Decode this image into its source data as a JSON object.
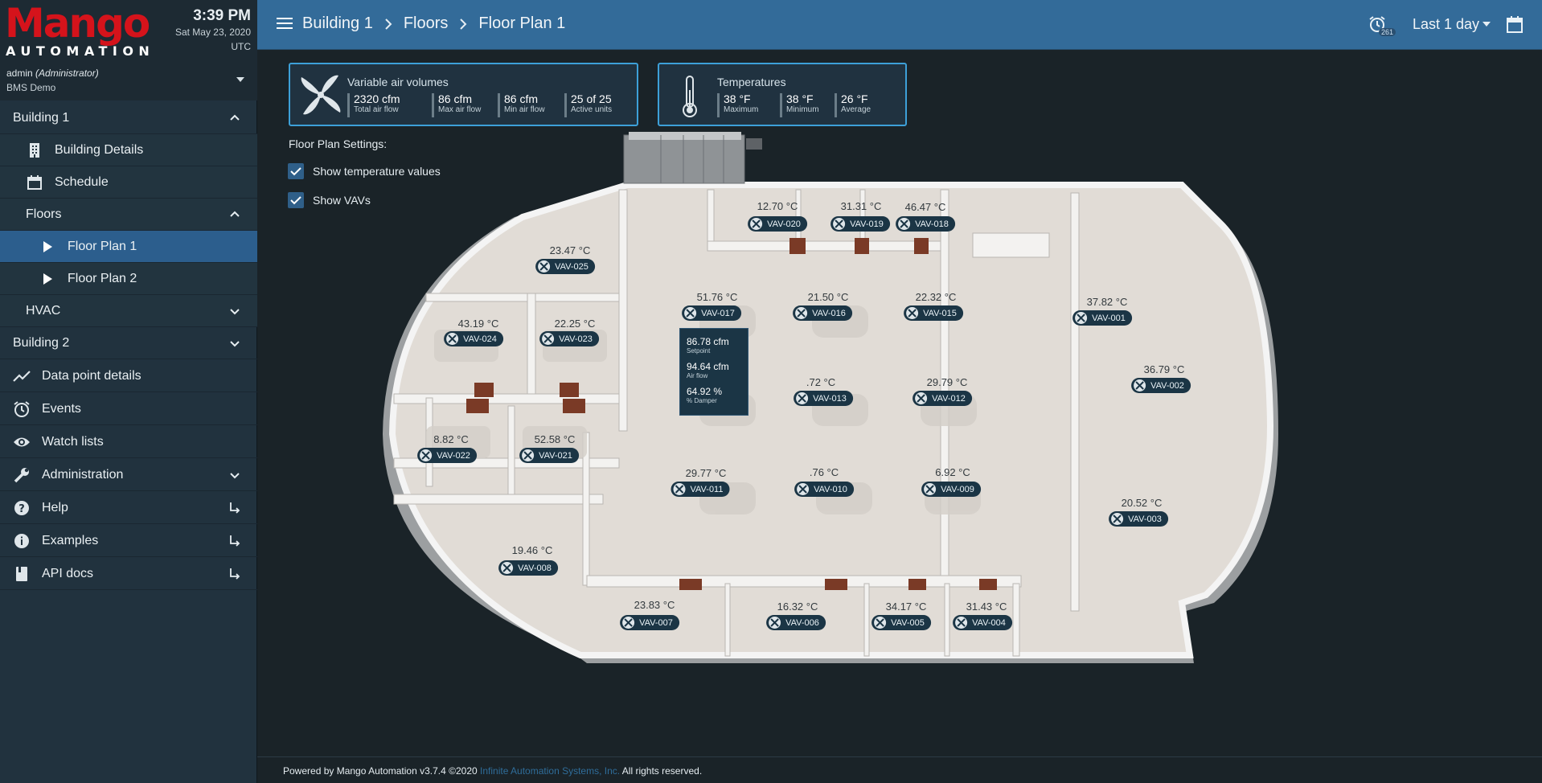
{
  "brand": {
    "logo_word": "Mango",
    "logo_sub": "AUTOMATION"
  },
  "clock": {
    "time": "3:39 PM",
    "date": "Sat May 23, 2020",
    "tz": "UTC"
  },
  "user": {
    "name": "admin",
    "role": "(Administrator)",
    "org": "BMS Demo"
  },
  "sidebar": {
    "items": [
      {
        "label": "Building 1",
        "icon": "chevron-up-icon"
      },
      {
        "label": "Building Details",
        "icon": "building-icon"
      },
      {
        "label": "Schedule",
        "icon": "calendar-icon"
      },
      {
        "label": "Floors",
        "icon": "chevron-up-icon"
      },
      {
        "label": "Floor Plan 1",
        "icon": "play-icon"
      },
      {
        "label": "Floor Plan 2",
        "icon": "play-icon"
      },
      {
        "label": "HVAC",
        "icon": "chevron-down-icon"
      },
      {
        "label": "Building 2",
        "icon": "chevron-down-icon"
      },
      {
        "label": "Data point details",
        "icon": "trending-icon"
      },
      {
        "label": "Events",
        "icon": "alarm-icon"
      },
      {
        "label": "Watch lists",
        "icon": "eye-icon"
      },
      {
        "label": "Administration",
        "icon": "wrench-icon"
      },
      {
        "label": "Help",
        "icon": "help-icon"
      },
      {
        "label": "Examples",
        "icon": "info-icon"
      },
      {
        "label": "API docs",
        "icon": "book-icon"
      }
    ]
  },
  "topbar": {
    "breadcrumbs": [
      "Building 1",
      "Floors",
      "Floor Plan 1"
    ],
    "history_badge": "261",
    "range_label": "Last 1 day"
  },
  "cards": {
    "vav": {
      "title": "Variable air volumes",
      "stats": [
        {
          "value": "2320 cfm",
          "caption": "Total air flow"
        },
        {
          "value": "86 cfm",
          "caption": "Max air flow"
        },
        {
          "value": "86 cfm",
          "caption": "Min air flow"
        },
        {
          "value": "25 of 25",
          "caption": "Active units"
        }
      ]
    },
    "temps": {
      "title": "Temperatures",
      "stats": [
        {
          "value": "38 °F",
          "caption": "Maximum"
        },
        {
          "value": "38 °F",
          "caption": "Minimum"
        },
        {
          "value": "26 °F",
          "caption": "Average"
        }
      ]
    }
  },
  "settings": {
    "title": "Floor Plan Settings:",
    "show_temps": "Show temperature values",
    "show_vavs": "Show VAVs"
  },
  "vavs": [
    {
      "id": "VAV-020",
      "temp": "12.70 °C"
    },
    {
      "id": "VAV-019",
      "temp": "31.31 °C"
    },
    {
      "id": "VAV-018",
      "temp": "46.47 °C"
    },
    {
      "id": "VAV-025",
      "temp": "23.47 °C"
    },
    {
      "id": "VAV-017",
      "temp": "51.76 °C"
    },
    {
      "id": "VAV-016",
      "temp": "21.50 °C"
    },
    {
      "id": "VAV-015",
      "temp": "22.32 °C"
    },
    {
      "id": "VAV-001",
      "temp": "37.82 °C"
    },
    {
      "id": "VAV-024",
      "temp": "43.19 °C"
    },
    {
      "id": "VAV-023",
      "temp": "22.25 °C"
    },
    {
      "id": "VAV-002",
      "temp": "36.79 °C"
    },
    {
      "id": "VAV-013",
      "temp": ".72 °C"
    },
    {
      "id": "VAV-012",
      "temp": "29.79 °C"
    },
    {
      "id": "VAV-022",
      "temp": "8.82 °C"
    },
    {
      "id": "VAV-021",
      "temp": "52.58 °C"
    },
    {
      "id": "VAV-011",
      "temp": "29.77 °C"
    },
    {
      "id": "VAV-010",
      "temp": ".76 °C"
    },
    {
      "id": "VAV-009",
      "temp": "6.92 °C"
    },
    {
      "id": "VAV-003",
      "temp": "20.52 °C"
    },
    {
      "id": "VAV-008",
      "temp": "19.46 °C"
    },
    {
      "id": "VAV-007",
      "temp": "23.83 °C"
    },
    {
      "id": "VAV-006",
      "temp": "16.32 °C"
    },
    {
      "id": "VAV-005",
      "temp": "34.17 °C"
    },
    {
      "id": "VAV-004",
      "temp": "31.43 °C"
    }
  ],
  "tooltip": [
    {
      "value": "86.78 cfm",
      "caption": "Setpoint"
    },
    {
      "value": "94.64 cfm",
      "caption": "Air flow"
    },
    {
      "value": "64.92 %",
      "caption": "% Damper"
    }
  ],
  "footer": {
    "prefix": "Powered by Mango Automation v3.7.4 ©2020",
    "link": "Infinite Automation Systems, Inc.",
    "suffix": "All rights reserved."
  },
  "colors": {
    "topbar": "#336b99",
    "sidebar": "#21323e",
    "brand_red": "#d5131b",
    "accent": "#3da0d8",
    "vav_chip": "#1b3545"
  }
}
